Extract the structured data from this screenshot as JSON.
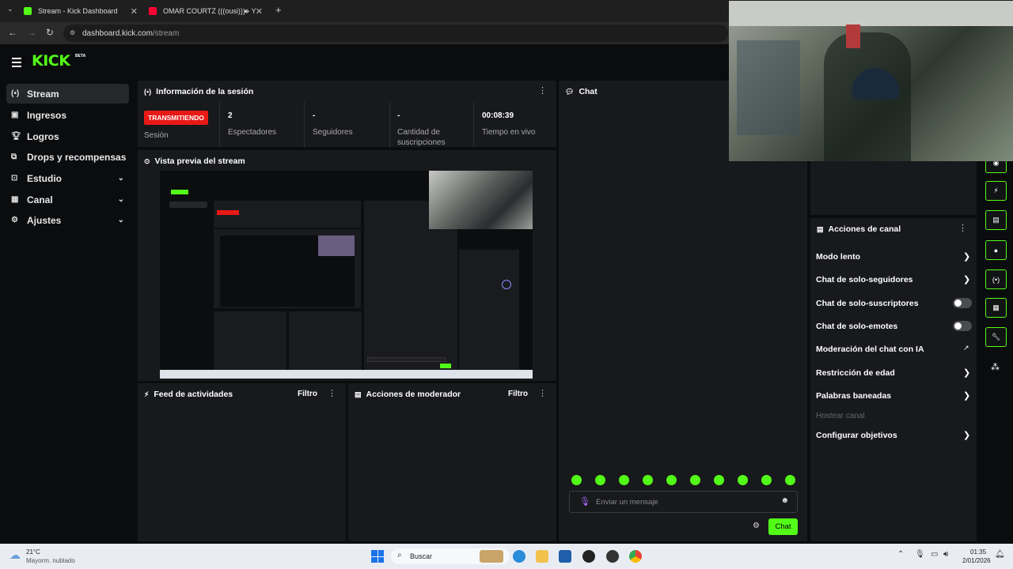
{
  "browser": {
    "tabs": [
      {
        "title": "Stream - Kick Dashboard"
      },
      {
        "title": "OMAR COURTZ (((ousi))) - Y"
      }
    ],
    "new_tab": "+",
    "url_host": "dashboard.kick.com",
    "url_path": "/stream"
  },
  "app": {
    "logo": "KICK",
    "logo_badge": "BETA",
    "menu_icon": "hamburger-icon"
  },
  "sidebar": {
    "items": [
      {
        "label": "Stream",
        "icon": "broadcast-icon"
      },
      {
        "label": "Ingresos",
        "icon": "revenue-icon"
      },
      {
        "label": "Logros",
        "icon": "trophy-icon"
      },
      {
        "label": "Drops y recompensas",
        "icon": "gift-icon"
      },
      {
        "label": "Estudio",
        "icon": "studio-icon"
      },
      {
        "label": "Canal",
        "icon": "channel-icon"
      },
      {
        "label": "Ajustes",
        "icon": "gear-icon"
      }
    ]
  },
  "session": {
    "title": "Información de la sesión",
    "badge": "TRANSMITIENDO",
    "stats": [
      {
        "value": "",
        "label": "Sesión"
      },
      {
        "value": "2",
        "label": "Espectadores"
      },
      {
        "value": "-",
        "label": "Seguidores"
      },
      {
        "value": "-",
        "label": "Cantidad de suscripciones"
      },
      {
        "value": "00:08:39",
        "label": "Tiempo en vivo"
      }
    ]
  },
  "preview": {
    "title": "Vista previa del stream"
  },
  "feed": {
    "title": "Feed de actividades",
    "filter": "Filtro"
  },
  "modactions": {
    "title": "Acciones de moderador",
    "filter": "Filtro"
  },
  "chat": {
    "title": "Chat",
    "placeholder": "Enviar un mensaje",
    "send_label": "Chat",
    "emote_count": 10
  },
  "channel_actions": {
    "title": "Acciones de canal",
    "items": [
      {
        "label": "Modo lento",
        "control": "arrow"
      },
      {
        "label": "Chat de solo-seguidores",
        "control": "arrow"
      },
      {
        "label": "Chat de solo-suscriptores",
        "control": "toggle"
      },
      {
        "label": "Chat de solo-emotes",
        "control": "toggle"
      },
      {
        "label": "Moderación del chat con IA",
        "control": "external"
      },
      {
        "label": "Restricción de edad",
        "control": "arrow"
      },
      {
        "label": "Palabras baneadas",
        "control": "arrow"
      },
      {
        "label": "Hostear canal",
        "control": "disabled"
      },
      {
        "label": "Configurar objetivos",
        "control": "arrow"
      }
    ]
  },
  "taskbar": {
    "weather_temp": "21°C",
    "weather_desc": "Mayorm. nublado",
    "search": "Buscar",
    "time": "01:35",
    "date": "2/01/2026"
  }
}
